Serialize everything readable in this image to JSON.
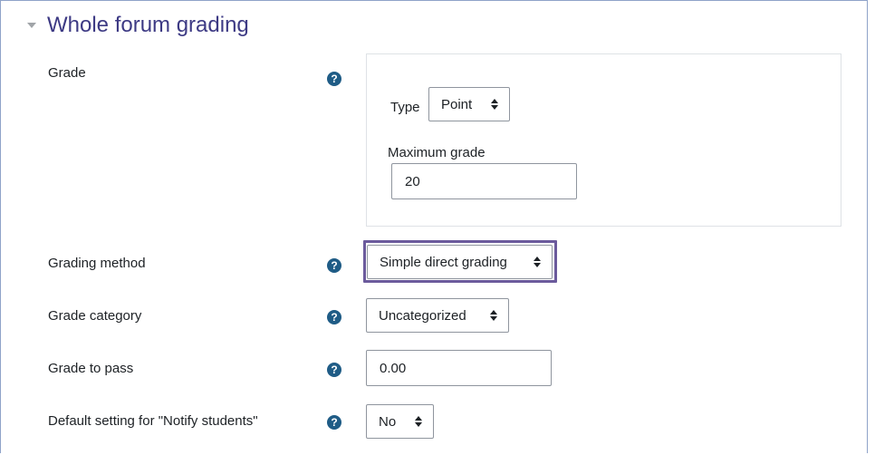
{
  "section": {
    "title": "Whole forum grading",
    "collapse_icon": "chevron-down-icon"
  },
  "grade": {
    "label": "Grade",
    "type_label": "Type",
    "type_value": "Point",
    "max_label": "Maximum grade",
    "max_value": "20"
  },
  "grading_method": {
    "label": "Grading method",
    "value": "Simple direct grading"
  },
  "grade_category": {
    "label": "Grade category",
    "value": "Uncategorized"
  },
  "grade_to_pass": {
    "label": "Grade to pass",
    "value": "0.00"
  },
  "notify": {
    "label": "Default setting for \"Notify students\"",
    "value": "No"
  },
  "colors": {
    "accent": "#3d3a84",
    "help_icon": "#0f6cbf",
    "highlight": "#6b5a9c"
  }
}
